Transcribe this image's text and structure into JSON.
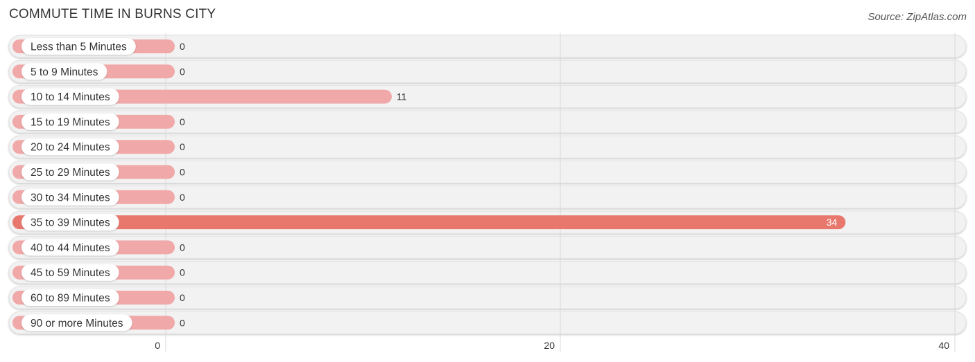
{
  "title": "COMMUTE TIME IN BURNS CITY",
  "source": "Source: ZipAtlas.com",
  "colors": {
    "bar_normal": "#f0a8a8",
    "bar_highlight": "#e8786e",
    "track": "#f2f2f2",
    "grid": "#d8d8d8",
    "label_text": "#333333"
  },
  "chart_data": {
    "type": "bar",
    "orientation": "horizontal",
    "title": "COMMUTE TIME IN BURNS CITY",
    "xlabel": "",
    "ylabel": "",
    "xlim": [
      0,
      40
    ],
    "x_ticks": [
      "0",
      "20",
      "40"
    ],
    "grid": true,
    "categories": [
      "Less than 5 Minutes",
      "5 to 9 Minutes",
      "10 to 14 Minutes",
      "15 to 19 Minutes",
      "20 to 24 Minutes",
      "25 to 29 Minutes",
      "30 to 34 Minutes",
      "35 to 39 Minutes",
      "40 to 44 Minutes",
      "45 to 59 Minutes",
      "60 to 89 Minutes",
      "90 or more Minutes"
    ],
    "values": [
      0,
      0,
      11,
      0,
      0,
      0,
      0,
      34,
      0,
      0,
      0,
      0
    ],
    "value_labels": [
      "0",
      "0",
      "11",
      "0",
      "0",
      "0",
      "0",
      "34",
      "0",
      "0",
      "0",
      "0"
    ],
    "highlight_index": 7
  }
}
